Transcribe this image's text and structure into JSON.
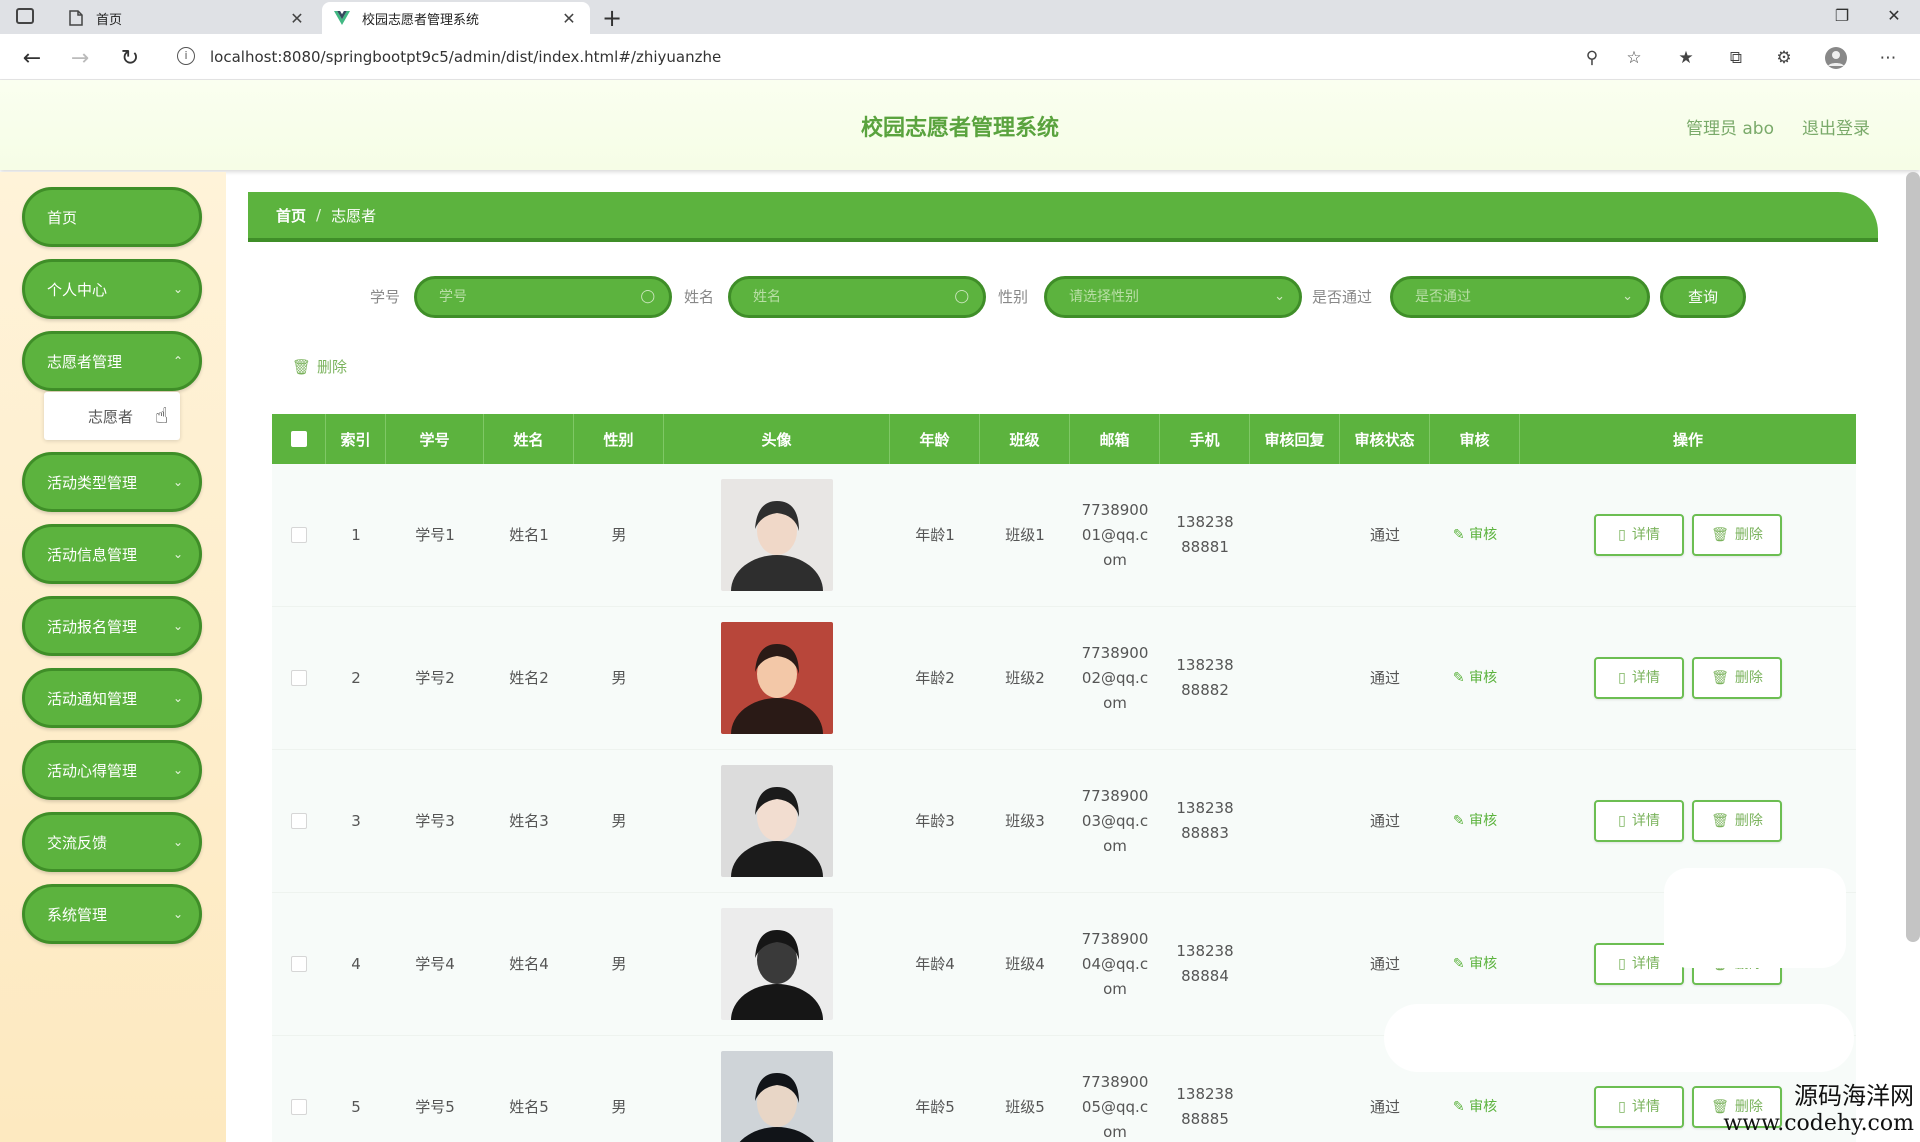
{
  "browser": {
    "tabs": [
      {
        "title": "首页",
        "icon": "page-icon"
      },
      {
        "title": "校园志愿者管理系统",
        "icon": "vue-logo-icon"
      }
    ],
    "url": "localhost:8080/springbootpt9c5/admin/dist/index.html#/zhiyuanzhe"
  },
  "header": {
    "title": "校园志愿者管理系统",
    "user": "管理员 abo",
    "logout": "退出登录"
  },
  "sidebar": {
    "items": [
      {
        "label": "首页"
      },
      {
        "label": "个人中心"
      },
      {
        "label": "志愿者管理"
      },
      {
        "label": "活动类型管理"
      },
      {
        "label": "活动信息管理"
      },
      {
        "label": "活动报名管理"
      },
      {
        "label": "活动通知管理"
      },
      {
        "label": "活动心得管理"
      },
      {
        "label": "交流反馈"
      },
      {
        "label": "系统管理"
      }
    ],
    "submenu": {
      "label": "志愿者"
    }
  },
  "breadcrumb": {
    "home": "首页",
    "sep": "/",
    "current": "志愿者"
  },
  "search": {
    "student_id_label": "学号",
    "student_id_placeholder": "学号",
    "name_label": "姓名",
    "name_placeholder": "姓名",
    "gender_label": "性别",
    "gender_placeholder": "请选择性别",
    "passed_label": "是否通过",
    "passed_placeholder": "是否通过",
    "query_button": "查询"
  },
  "actions": {
    "bulk_delete": "删除"
  },
  "table": {
    "headers": [
      "索引",
      "学号",
      "姓名",
      "性别",
      "头像",
      "年龄",
      "班级",
      "邮箱",
      "手机",
      "审核回复",
      "审核状态",
      "审核",
      "操作"
    ],
    "audit_label": "审核",
    "detail_label": "详情",
    "delete_label": "删除",
    "rows": [
      {
        "index": "1",
        "student_id": "学号1",
        "name": "姓名1",
        "gender": "男",
        "age": "年龄1",
        "class": "班级1",
        "email": "773890001@qq.com",
        "phone": "13823888881",
        "reply": "",
        "status": "通过"
      },
      {
        "index": "2",
        "student_id": "学号2",
        "name": "姓名2",
        "gender": "男",
        "age": "年龄2",
        "class": "班级2",
        "email": "773890002@qq.com",
        "phone": "13823888882",
        "reply": "",
        "status": "通过"
      },
      {
        "index": "3",
        "student_id": "学号3",
        "name": "姓名3",
        "gender": "男",
        "age": "年龄3",
        "class": "班级3",
        "email": "773890003@qq.com",
        "phone": "13823888883",
        "reply": "",
        "status": "通过"
      },
      {
        "index": "4",
        "student_id": "学号4",
        "name": "姓名4",
        "gender": "男",
        "age": "年龄4",
        "class": "班级4",
        "email": "773890004@qq.com",
        "phone": "13823888884",
        "reply": "",
        "status": "通过"
      },
      {
        "index": "5",
        "student_id": "学号5",
        "name": "姓名5",
        "gender": "男",
        "age": "年龄5",
        "class": "班级5",
        "email": "773890005@qq.com",
        "phone": "13823888885",
        "reply": "",
        "status": "通过"
      }
    ]
  },
  "watermark": {
    "line1": "源码海洋网",
    "line2": "www.codehy.com"
  },
  "colors": {
    "primary": "#5cb33e",
    "primary_dark": "#3f8e28",
    "sidebar_bg": "#fdebc4",
    "header_bg": "#f6fde6"
  }
}
